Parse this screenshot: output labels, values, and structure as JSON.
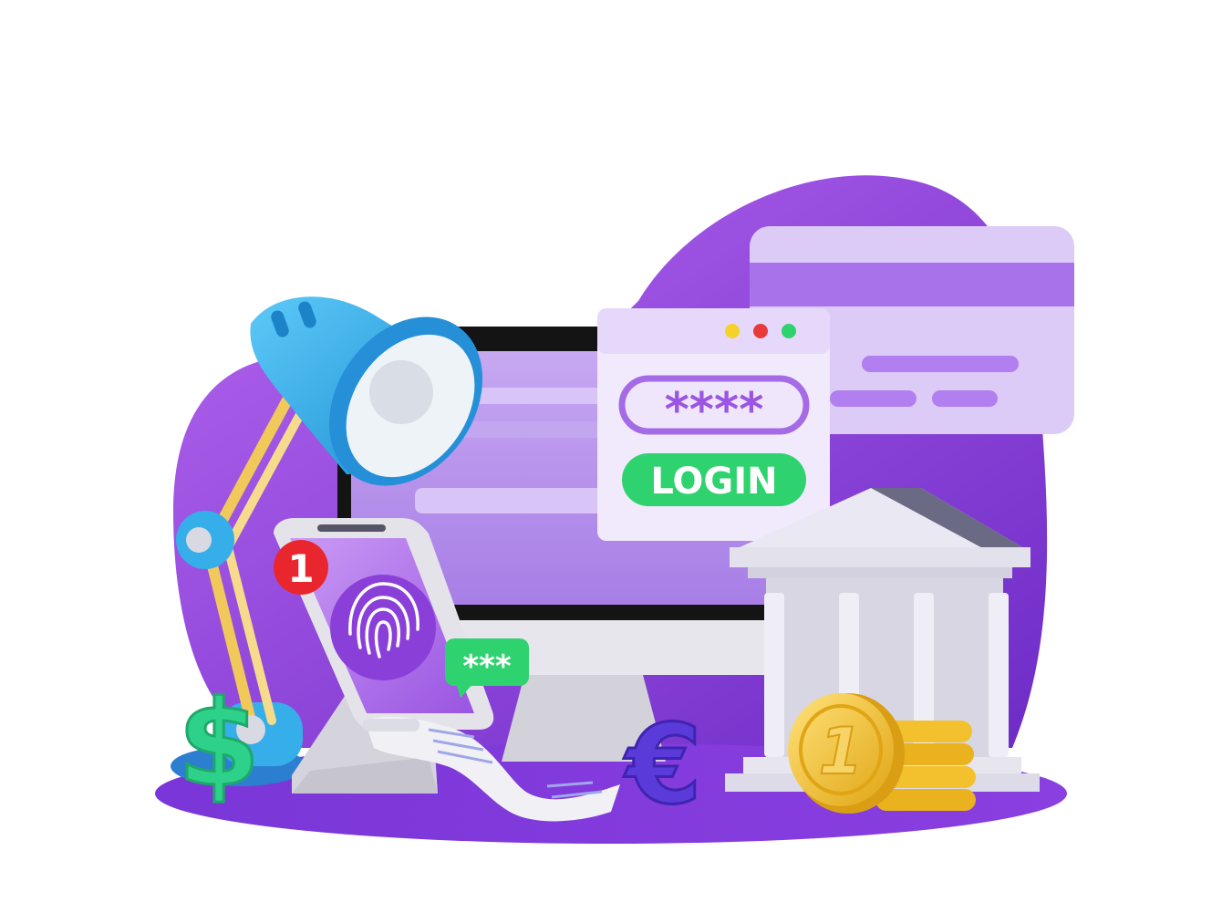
{
  "login_window": {
    "password_mask": "****",
    "button_label": "LOGIN"
  },
  "phone": {
    "notification_count": "1",
    "chat_mask": "***"
  },
  "symbols": {
    "dollar": "$",
    "euro": "€"
  },
  "coin": {
    "value": "1"
  },
  "colors": {
    "purple_blob": "#9b4fe0",
    "card": "#d9c6f6",
    "login_button": "#2ed36f",
    "lamp": "#35aee9",
    "coin": "#f3c12d",
    "bank": "#d6d3e4",
    "notification": "#e9262d"
  }
}
